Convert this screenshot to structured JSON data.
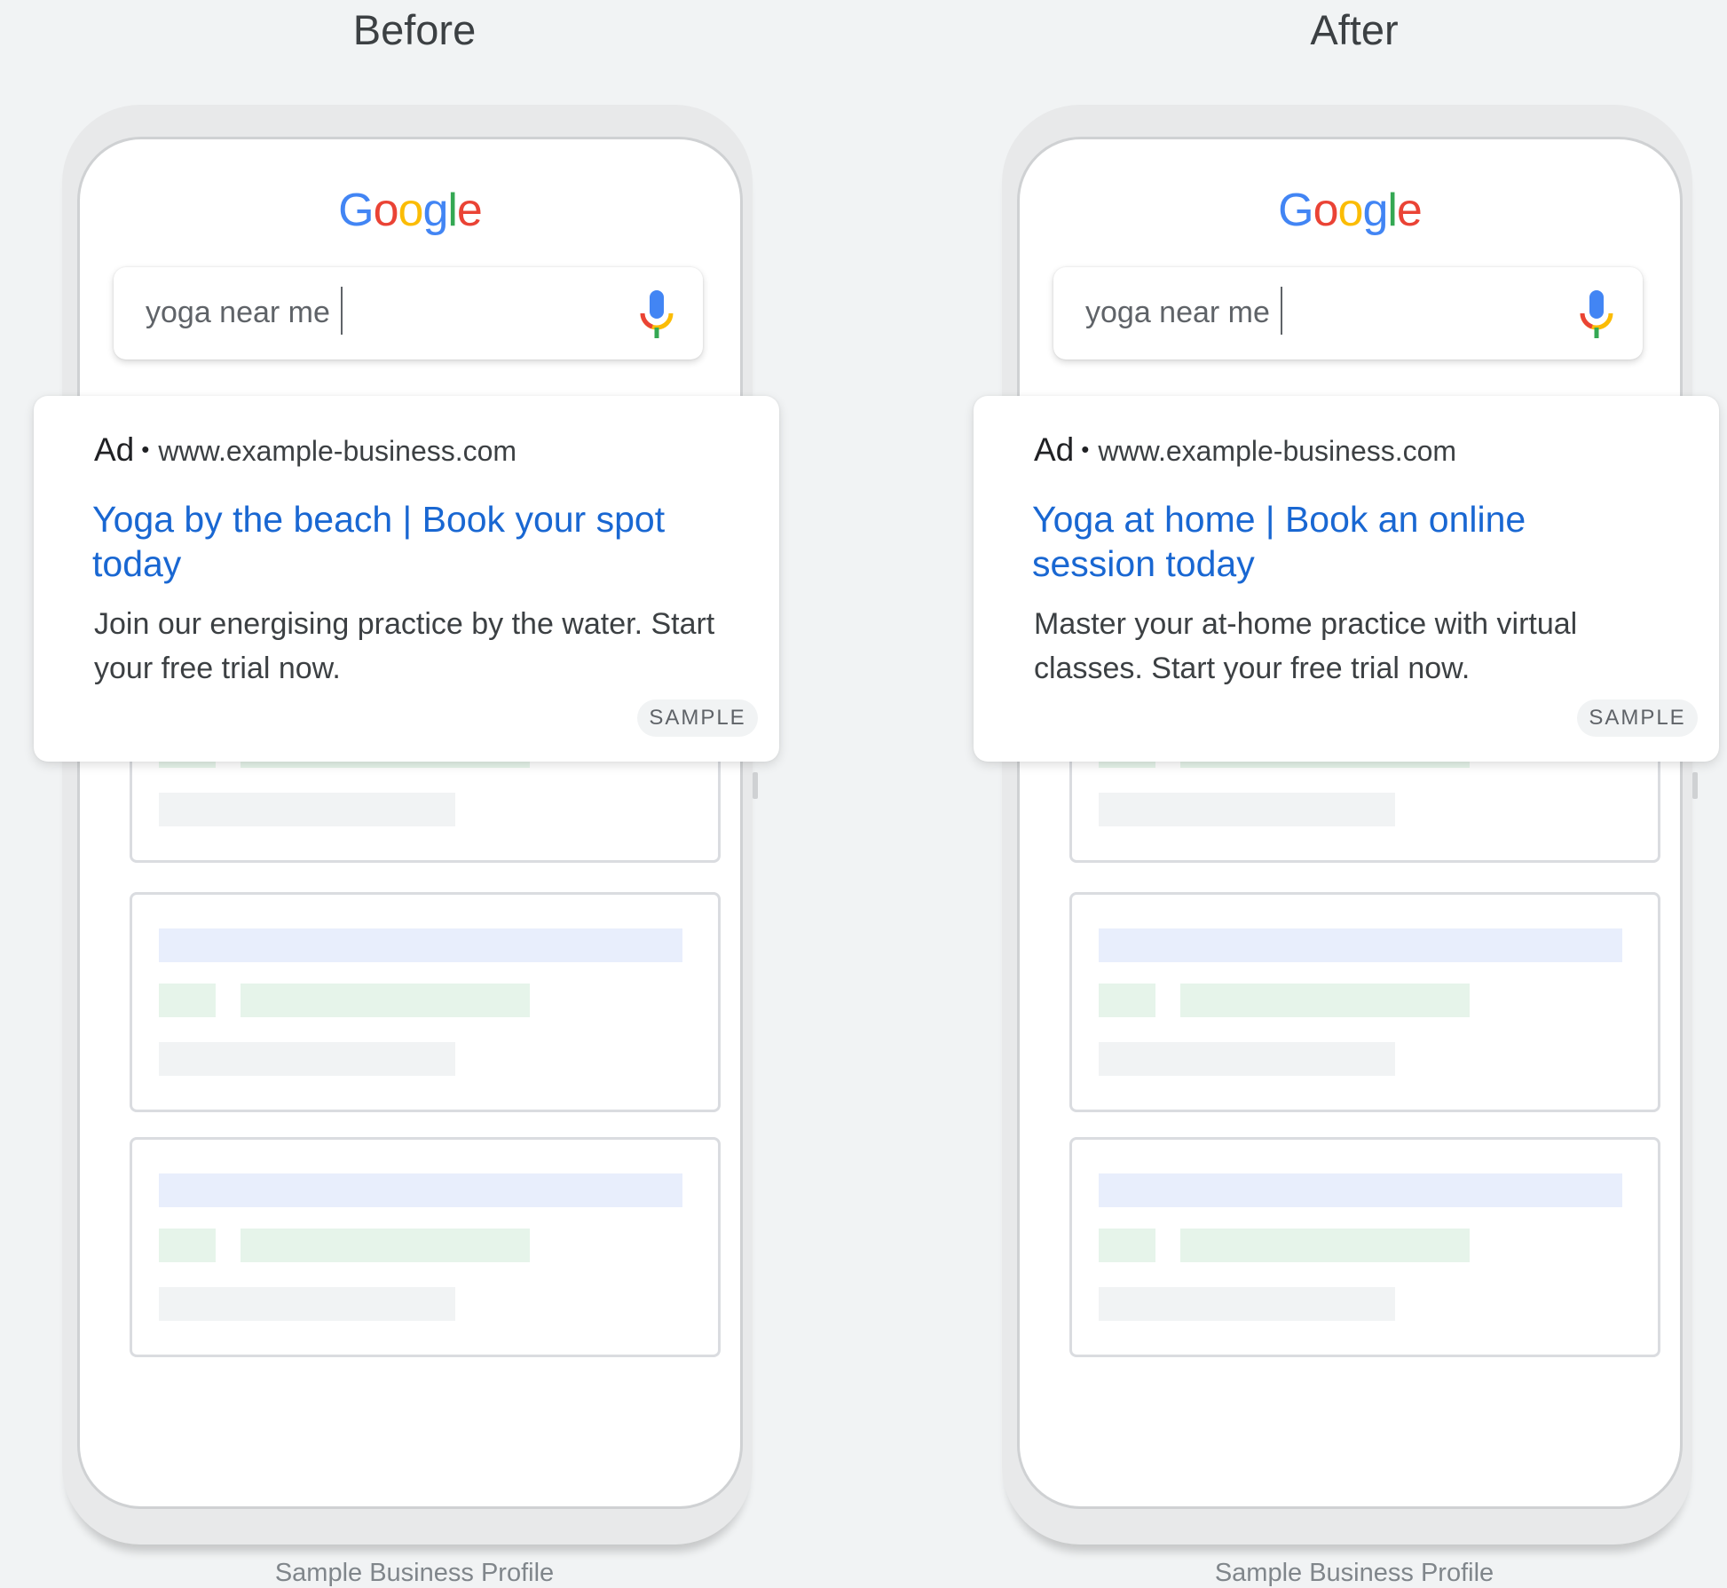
{
  "colors": {
    "background": "#f1f3f4",
    "link_blue": "#1967d2",
    "google_blue": "#4285f4",
    "google_red": "#ea4335",
    "google_yellow": "#fbbc05",
    "google_green": "#34a853"
  },
  "panels": [
    {
      "heading": "Before",
      "logo_letters": [
        "G",
        "o",
        "o",
        "g",
        "l",
        "e"
      ],
      "search": {
        "query": "yoga near me",
        "mic_icon": "mic-icon"
      },
      "ad": {
        "label": "Ad",
        "separator": "•",
        "url": "www.example-business.com",
        "headline": "Yoga by the beach | Book your spot today",
        "description": "Join our energising practice by the water. Start your free trial now.",
        "badge": "SAMPLE"
      },
      "caption": "Sample Business Profile"
    },
    {
      "heading": "After",
      "logo_letters": [
        "G",
        "o",
        "o",
        "g",
        "l",
        "e"
      ],
      "search": {
        "query": "yoga near me",
        "mic_icon": "mic-icon"
      },
      "ad": {
        "label": "Ad",
        "separator": "•",
        "url": "www.example-business.com",
        "headline": "Yoga at home | Book an online session today",
        "description": "Master your at-home practice with virtual classes. Start your free trial now.",
        "badge": "SAMPLE"
      },
      "caption": "Sample Business Profile"
    }
  ]
}
